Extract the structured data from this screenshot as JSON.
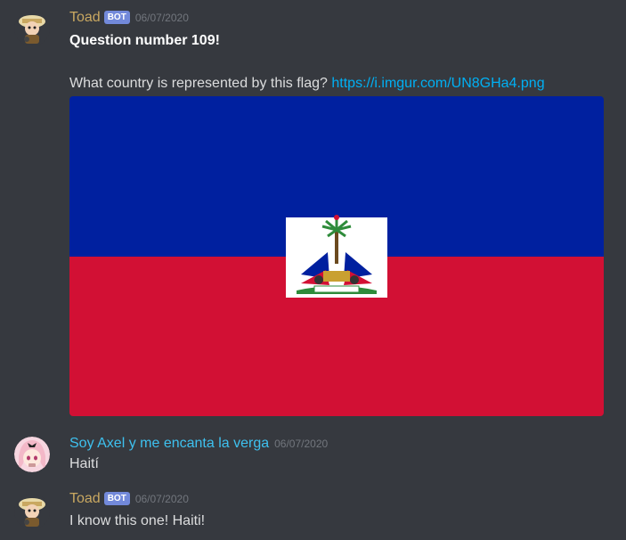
{
  "messages": [
    {
      "username": "Toad",
      "bot_tag": "BOT",
      "timestamp": "06/07/2020",
      "title": "Question number 109!",
      "question": "What country is represented by this flag?",
      "link": "https://i.imgur.com/UN8GHa4.png",
      "image": {
        "type": "flag",
        "country_flag": "Haiti",
        "top_color": "#00209f",
        "bottom_color": "#d21034"
      }
    },
    {
      "username": "Soy Axel y me encanta la verga",
      "timestamp": "06/07/2020",
      "text": "Haití"
    },
    {
      "username": "Toad",
      "bot_tag": "BOT",
      "timestamp": "06/07/2020",
      "text": "I know this one! Haiti!"
    }
  ],
  "colors": {
    "background": "#36393f",
    "toad_name": "#c9a861",
    "axel_name": "#3ec1ef",
    "bot_tag_bg": "#7289da",
    "link": "#00b0f4"
  }
}
